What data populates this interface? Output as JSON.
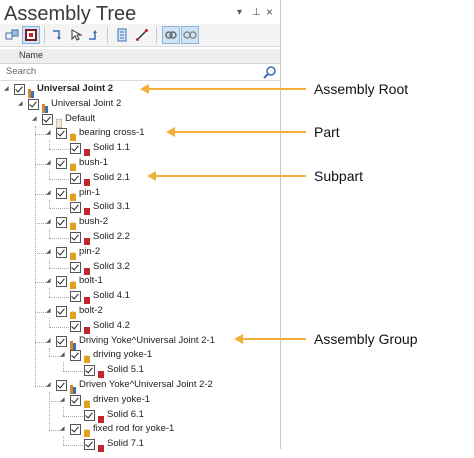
{
  "panel": {
    "title": "Assembly Tree",
    "controls": {
      "dropdown": "▾",
      "pin": "⊥",
      "close": "×"
    }
  },
  "toolbar": {
    "buttons": [
      {
        "name": "tree-view-icon"
      },
      {
        "name": "filter-icon"
      },
      {
        "name": "expand-icon"
      },
      {
        "name": "pointer-icon"
      },
      {
        "name": "collapse-icon"
      },
      {
        "name": "document-icon"
      },
      {
        "name": "measure-icon"
      },
      {
        "name": "link-icon"
      },
      {
        "name": "unlink-icon"
      }
    ]
  },
  "columns": {
    "name": "Name"
  },
  "search": {
    "placeholder": "Search"
  },
  "tree": [
    {
      "label": "Universal Joint 2",
      "bold": true,
      "kind": "root"
    },
    {
      "label": "Universal Joint 2",
      "kind": "assembly"
    },
    {
      "label": "Default",
      "kind": "config"
    },
    {
      "label": "bearing cross-1",
      "kind": "part"
    },
    {
      "label": "Solid 1.1",
      "kind": "solid"
    },
    {
      "label": "bush-1",
      "kind": "part"
    },
    {
      "label": "Solid 2.1",
      "kind": "solid"
    },
    {
      "label": "pin-1",
      "kind": "part"
    },
    {
      "label": "Solid 3.1",
      "kind": "solid"
    },
    {
      "label": "bush-2",
      "kind": "part"
    },
    {
      "label": "Solid 2.2",
      "kind": "solid"
    },
    {
      "label": "pin-2",
      "kind": "part"
    },
    {
      "label": "Solid 3.2",
      "kind": "solid"
    },
    {
      "label": "bolt-1",
      "kind": "part"
    },
    {
      "label": "Solid 4.1",
      "kind": "solid"
    },
    {
      "label": "bolt-2",
      "kind": "part"
    },
    {
      "label": "Solid 4.2",
      "kind": "solid"
    },
    {
      "label": "Driving Yoke^Universal Joint 2-1",
      "kind": "assembly"
    },
    {
      "label": "driving yoke-1",
      "kind": "part"
    },
    {
      "label": "Solid 5.1",
      "kind": "solid"
    },
    {
      "label": "Driven Yoke^Universal Joint 2-2",
      "kind": "assembly"
    },
    {
      "label": "driven yoke-1",
      "kind": "part"
    },
    {
      "label": "Solid 6.1",
      "kind": "solid"
    },
    {
      "label": "fixed rod for yoke-1",
      "kind": "part"
    },
    {
      "label": "Solid 7.1",
      "kind": "solid"
    }
  ],
  "annotations": [
    {
      "text": "Assembly Root"
    },
    {
      "text": "Part"
    },
    {
      "text": "Subpart"
    },
    {
      "text": "Assembly Group"
    }
  ],
  "colors": {
    "arrow": "#f2b03a",
    "part_icon": "#e0a020",
    "solid_icon": "#c0282e",
    "assembly_icon": "#d4892a"
  }
}
